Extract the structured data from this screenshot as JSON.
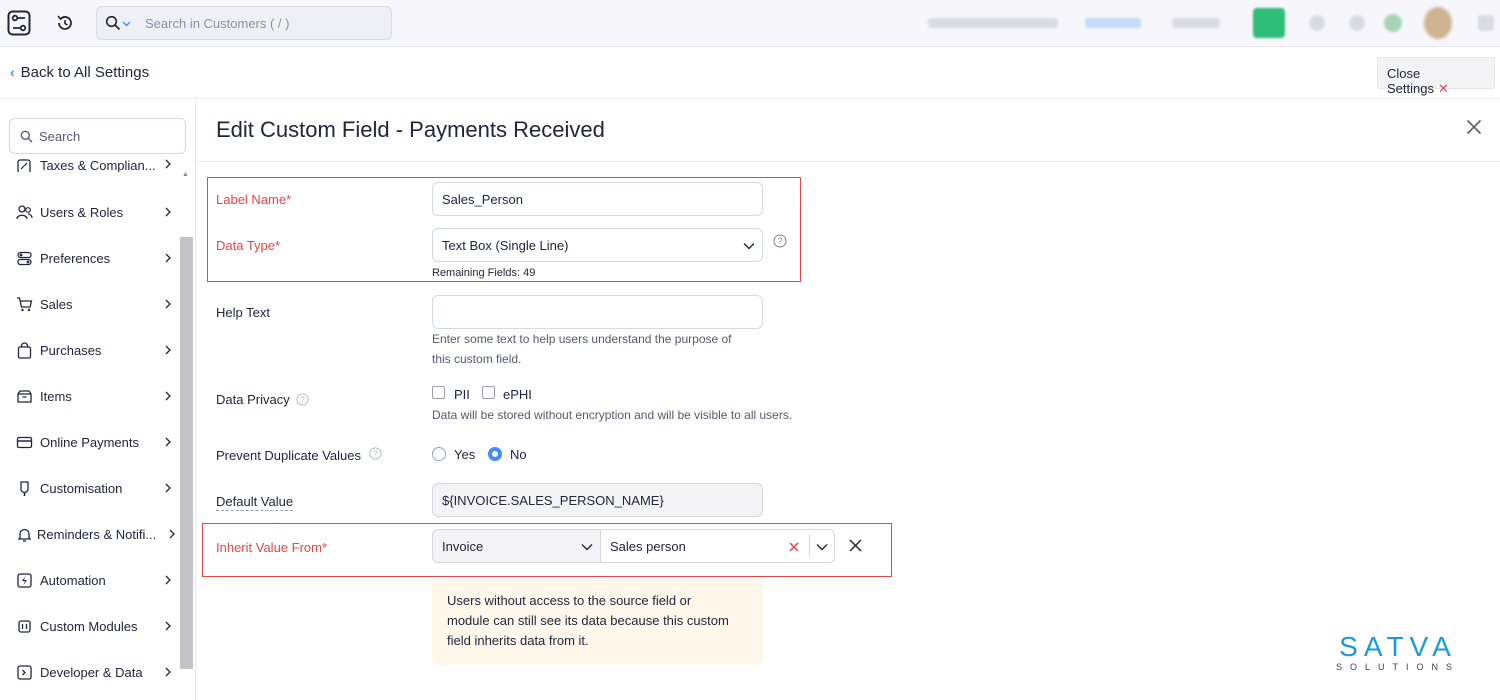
{
  "topbar": {
    "search_placeholder": "Search in Customers ( / )"
  },
  "subheader": {
    "back_label": "Back to All Settings",
    "close_settings_label": "Close Settings"
  },
  "sidebar": {
    "search_placeholder": "Search",
    "items": [
      {
        "label": "Taxes & Complian...",
        "icon": "taxes-icon"
      },
      {
        "label": "Users & Roles",
        "icon": "users-icon"
      },
      {
        "label": "Preferences",
        "icon": "preferences-icon"
      },
      {
        "label": "Sales",
        "icon": "cart-icon"
      },
      {
        "label": "Purchases",
        "icon": "bag-icon"
      },
      {
        "label": "Items",
        "icon": "box-icon"
      },
      {
        "label": "Online Payments",
        "icon": "card-icon"
      },
      {
        "label": "Customisation",
        "icon": "brush-icon"
      },
      {
        "label": "Reminders & Notifi...",
        "icon": "bell-icon"
      },
      {
        "label": "Automation",
        "icon": "automation-icon"
      },
      {
        "label": "Custom Modules",
        "icon": "modules-icon"
      },
      {
        "label": "Developer & Data",
        "icon": "code-icon"
      }
    ]
  },
  "main": {
    "title": "Edit Custom Field - Payments Received",
    "label_name": {
      "label": "Label Name*",
      "value": "Sales_Person"
    },
    "data_type": {
      "label": "Data Type*",
      "value": "Text Box (Single Line)",
      "remaining": "Remaining Fields: 49"
    },
    "help_text": {
      "label": "Help Text",
      "value": "",
      "hint_line1": "Enter some text to help users understand the purpose of",
      "hint_line2": "this custom field."
    },
    "data_privacy": {
      "label": "Data Privacy",
      "options": [
        "PII",
        "ePHI"
      ],
      "hint": "Data will be stored without encryption and will be visible to all users."
    },
    "prevent_duplicates": {
      "label": "Prevent Duplicate Values",
      "options": [
        "Yes",
        "No"
      ],
      "selected": "No"
    },
    "default_value": {
      "label": "Default Value",
      "value": "${INVOICE.SALES_PERSON_NAME}"
    },
    "inherit": {
      "label": "Inherit Value From*",
      "module": "Invoice",
      "field": "Sales person"
    },
    "note_lines": [
      "Users without access to the source field or",
      "module can still see its data because this custom",
      "field inherits data from it."
    ]
  },
  "watermark": {
    "brand": "SATVA",
    "tagline": "SOLUTIONS"
  },
  "colors": {
    "accent": "#408dfb",
    "required": "#e0474b",
    "highlight": "#e0474b",
    "brand": "#1a9bd7"
  }
}
